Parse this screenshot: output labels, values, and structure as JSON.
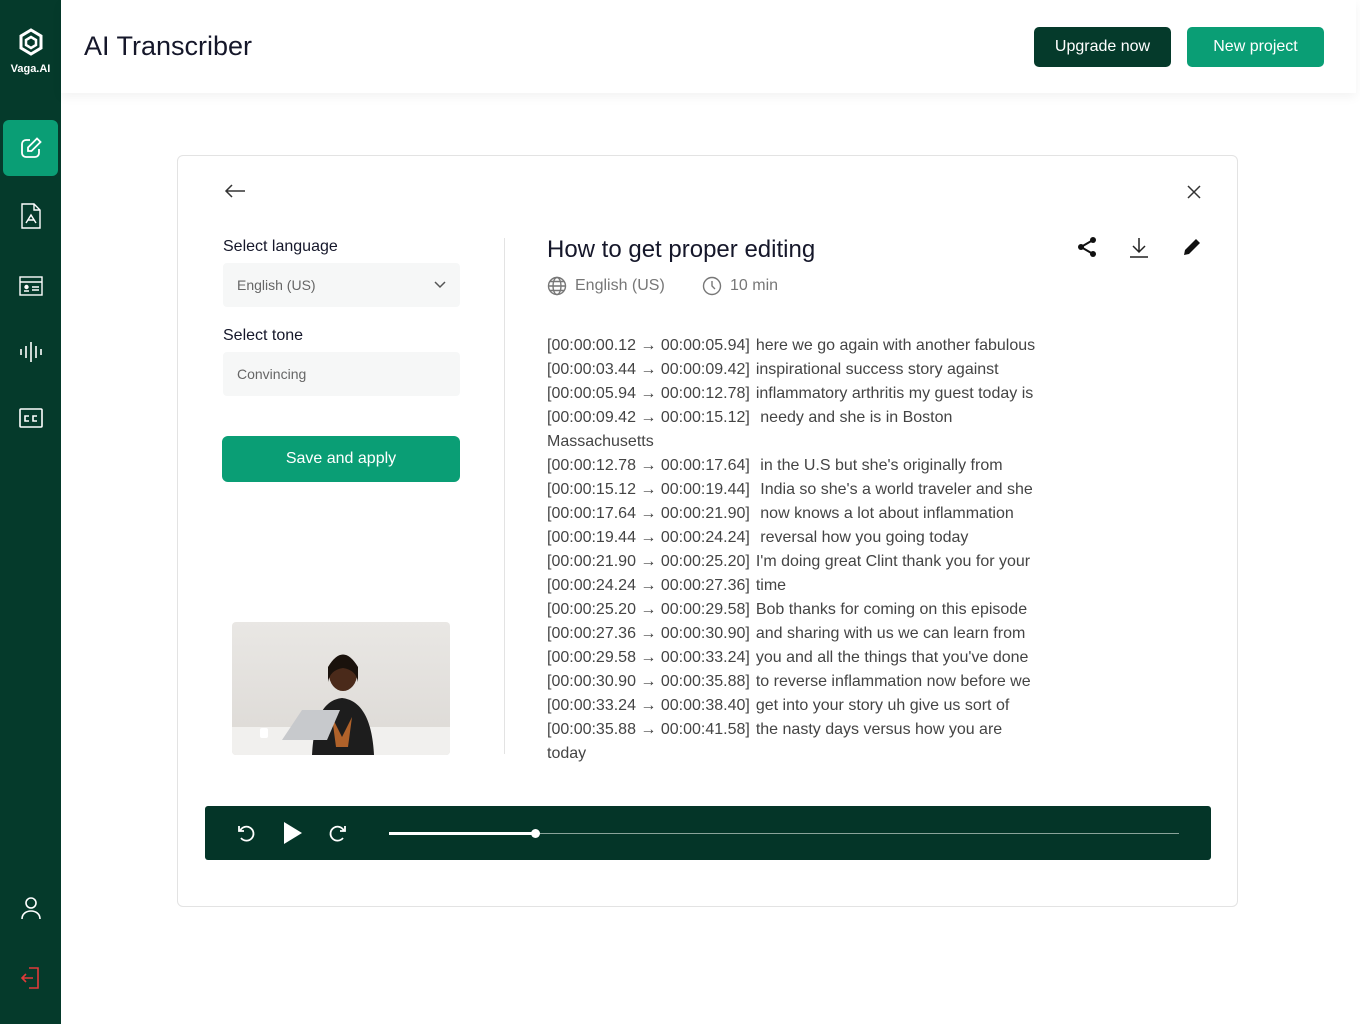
{
  "brand": {
    "name": "Vaga.AI"
  },
  "header": {
    "title": "AI Transcriber",
    "upgrade_label": "Upgrade now",
    "new_project_label": "New project"
  },
  "sidebar": {
    "items": [
      {
        "icon": "edit-icon",
        "active": true
      },
      {
        "icon": "pdf-icon"
      },
      {
        "icon": "id-card-icon"
      },
      {
        "icon": "waveform-icon"
      },
      {
        "icon": "closed-caption-icon"
      }
    ],
    "bottom": [
      {
        "icon": "user-icon"
      },
      {
        "icon": "logout-icon"
      }
    ]
  },
  "settings": {
    "language_label": "Select language",
    "language_value": "English (US)",
    "tone_label": "Select tone",
    "tone_value": "Convincing",
    "save_label": "Save and apply"
  },
  "transcript": {
    "title": "How to get proper editing",
    "language": "English (US)",
    "duration": "10 min",
    "lines": [
      {
        "ts": "[00:00:00.12 → 00:00:05.94]",
        "text": "here we go again with another fabulous"
      },
      {
        "ts": "[00:00:03.44 → 00:00:09.42]",
        "text": "inspirational success story against"
      },
      {
        "ts": "[00:00:05.94 → 00:00:12.78]",
        "text": "inflammatory arthritis my guest today is"
      },
      {
        "ts": "[00:00:09.42 → 00:00:15.12]",
        "text": " needy and she is in Boston"
      },
      {
        "ts": "",
        "text": "Massachusetts"
      },
      {
        "ts": "[00:00:12.78 → 00:00:17.64]",
        "text": " in the U.S but she's originally from"
      },
      {
        "ts": "[00:00:15.12 → 00:00:19.44]",
        "text": " India so she's a world traveler and she"
      },
      {
        "ts": "[00:00:17.64 → 00:00:21.90]",
        "text": " now knows a lot about inflammation"
      },
      {
        "ts": "[00:00:19.44 → 00:00:24.24]",
        "text": " reversal how you going today"
      },
      {
        "ts": "[00:00:21.90 → 00:00:25.20]",
        "text": "I'm doing great Clint thank you for your"
      },
      {
        "ts": "[00:00:24.24 → 00:00:27.36]",
        "text": "time"
      },
      {
        "ts": "[00:00:25.20 → 00:00:29.58]",
        "text": "Bob thanks for coming on this episode"
      },
      {
        "ts": "[00:00:27.36 → 00:00:30.90]",
        "text": "and sharing with us we can learn from"
      },
      {
        "ts": "[00:00:29.58 → 00:00:33.24]",
        "text": "you and all the things that you've done"
      },
      {
        "ts": "[00:00:30.90 → 00:00:35.88]",
        "text": "to reverse inflammation now before we"
      },
      {
        "ts": "[00:00:33.24 → 00:00:38.40]",
        "text": "get into your story uh give us sort of"
      },
      {
        "ts": "[00:00:35.88 → 00:00:41.58]",
        "text": "the nasty days versus how you are"
      },
      {
        "ts": "",
        "text": "today"
      }
    ]
  },
  "player": {
    "progress_percent": 18.5
  },
  "colors": {
    "sidebar": "#053a2b",
    "accent": "#0a9e75",
    "player": "#043528"
  }
}
